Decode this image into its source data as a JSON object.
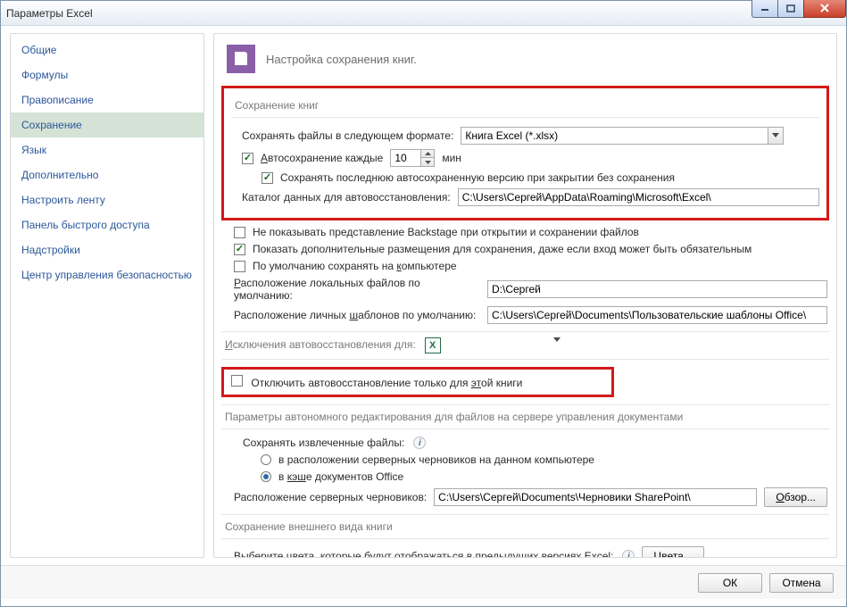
{
  "window": {
    "title": "Параметры Excel"
  },
  "sidebar": {
    "items": [
      "Общие",
      "Формулы",
      "Правописание",
      "Сохранение",
      "Язык",
      "Дополнительно",
      "Настроить ленту",
      "Панель быстрого доступа",
      "Надстройки",
      "Центр управления безопасностью"
    ],
    "active_index": 3
  },
  "header": {
    "title": "Настройка сохранения книг."
  },
  "sec1": {
    "title": "Сохранение книг",
    "save_format_label": "Сохранять файлы в следующем формате:",
    "save_format_value": "Книга Excel (*.xlsx)",
    "autosave_label_before": "Автосохранение каждые",
    "autosave_value": "10",
    "autosave_label_after": "мин",
    "keep_last_label": "Сохранять последнюю автосохраненную версию при закрытии без сохранения",
    "autorecover_dir_label": "Каталог данных для автовосстановления:",
    "autorecover_dir_value": "C:\\Users\\Сергей\\AppData\\Roaming\\Microsoft\\Excel\\"
  },
  "sec1b": {
    "no_backstage": "Не показывать представление Backstage при открытии и сохранении файлов",
    "show_places": "Показать дополнительные размещения для сохранения, даже если вход может быть обязательным",
    "save_local": "По умолчанию сохранять на компьютере",
    "local_files_label": "Расположение локальных файлов по умолчанию:",
    "local_files_value": "D:\\Сергей",
    "templates_label": "Расположение личных шаблонов по умолчанию:",
    "templates_value": "C:\\Users\\Сергей\\Documents\\Пользовательские шаблоны Office\\"
  },
  "sec2": {
    "title": "Исключения автовосстановления для:",
    "disable_autorecover": "Отключить автовосстановление только для этой книги"
  },
  "sec3": {
    "title": "Параметры автономного редактирования для файлов на сервере управления документами",
    "extracted_label": "Сохранять извлеченные файлы:",
    "opt1": "в расположении серверных черновиков на данном компьютере",
    "opt2": "в кэше документов Office",
    "drafts_label": "Расположение серверных черновиков:",
    "drafts_value": "C:\\Users\\Сергей\\Documents\\Черновики SharePoint\\",
    "browse": "Обзор..."
  },
  "sec4": {
    "title": "Сохранение внешнего вида книги",
    "colors_label": "Выберите цвета, которые будут отображаться в предыдущих версиях Excel:",
    "colors_btn": "Цвета..."
  },
  "footer": {
    "ok": "ОК",
    "cancel": "Отмена"
  },
  "underline": {
    "a": "А",
    "z": "з",
    "d": "д",
    "k": "к",
    "r": "Р",
    "sh": "ш",
    "i": "И",
    "et": "эт",
    "kesh": "кэш",
    "ob": "О",
    "tsv": "Ц"
  }
}
